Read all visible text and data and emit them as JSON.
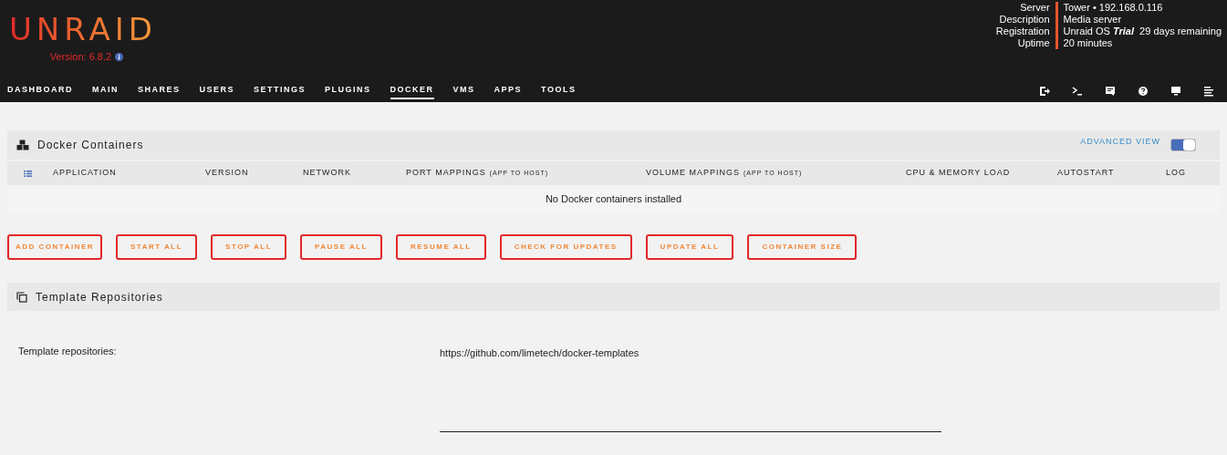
{
  "header": {
    "logo": "UNRAID",
    "version": "Version: 6.8.2",
    "info": [
      {
        "label": "Server",
        "value": "Tower • 192.168.0.116"
      },
      {
        "label": "Description",
        "value": "Media server"
      },
      {
        "label": "Registration",
        "value": "Unraid OS *Trial*  29 days remaining"
      },
      {
        "label": "Uptime",
        "value": "20 minutes"
      }
    ]
  },
  "nav": {
    "tabs": [
      {
        "label": "DASHBOARD",
        "selected": false
      },
      {
        "label": "MAIN",
        "selected": false
      },
      {
        "label": "SHARES",
        "selected": false
      },
      {
        "label": "USERS",
        "selected": false
      },
      {
        "label": "SETTINGS",
        "selected": false
      },
      {
        "label": "PLUGINS",
        "selected": false
      },
      {
        "label": "DOCKER",
        "selected": true
      },
      {
        "label": "VMS",
        "selected": false
      },
      {
        "label": "APPS",
        "selected": false
      },
      {
        "label": "TOOLS",
        "selected": false
      }
    ]
  },
  "docker": {
    "title": "Docker Containers",
    "advanced_view": {
      "label": "ADVANCED VIEW",
      "on": true
    },
    "columns": [
      {
        "label": "APPLICATION"
      },
      {
        "label": "VERSION"
      },
      {
        "label": "NETWORK"
      },
      {
        "label": "PORT MAPPINGS",
        "note": "(APP TO HOST)"
      },
      {
        "label": "VOLUME MAPPINGS",
        "note": "(APP TO HOST)"
      },
      {
        "label": "CPU & MEMORY LOAD"
      },
      {
        "label": "AUTOSTART"
      },
      {
        "label": "LOG"
      }
    ],
    "empty": "No Docker containers installed",
    "buttons": [
      "ADD CONTAINER",
      "START ALL",
      "STOP ALL",
      "PAUSE ALL",
      "RESUME ALL",
      "CHECK FOR UPDATES",
      "UPDATE ALL",
      "CONTAINER SIZE"
    ]
  },
  "templates": {
    "title": "Template Repositories",
    "label": "Template repositories:",
    "value": "https://github.com/limetech/docker-templates"
  }
}
